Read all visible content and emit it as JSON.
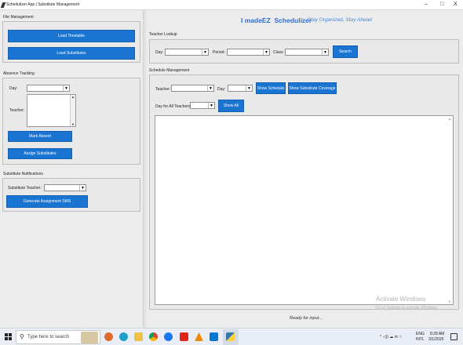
{
  "window": {
    "title": "Schedulizer App | Substitute Management",
    "minimize": "–",
    "maximize": "□",
    "close": "X"
  },
  "left": {
    "file_management": {
      "label": "File Management",
      "load_timetable": "Load Timetable",
      "load_substitutes": "Load Substitutes"
    },
    "absence": {
      "label": "Absence Tracking",
      "day_label": "Day:",
      "teacher_label": "Teacher:",
      "mark_absent": "Mark Absent",
      "assign_substitutes": "Assign Substitutes"
    },
    "notifications": {
      "label": "Substitute Notifications",
      "sub_teacher_label": "Substitute Teacher:",
      "generate_sms": "Generate Assignment SMS"
    }
  },
  "header": {
    "brand": "I madeEZ  Schedulizer",
    "tagline": "Stay Organized, Stay Ahead",
    "brand_color": "#2f6fc9"
  },
  "teacher_lookup": {
    "label": "Teacher Lookup",
    "day_label": "Day:",
    "period_label": "Period:",
    "class_label": "Class:",
    "search": "Search"
  },
  "schedule_management": {
    "label": "Schedule Management",
    "teacher_label": "Teacher:",
    "day_label": "Day:",
    "show_schedule": "Show Schedule",
    "show_substitute_coverage": "Show Substitute Coverage",
    "day_for_all_label": "Day for All Teachers:",
    "show_all": "Show All"
  },
  "status": {
    "text": "Ready for input..."
  },
  "watermark": {
    "line1": "Activate Windows",
    "line2": "Go to Settings to activate Windows."
  },
  "taskbar": {
    "search_placeholder": "Type here to search",
    "lang": "ENG",
    "region": "INTL",
    "time": "8:28 AM",
    "date": "3/1/2025",
    "tray": "^ ◁)) ☁ ✉ ☆"
  }
}
